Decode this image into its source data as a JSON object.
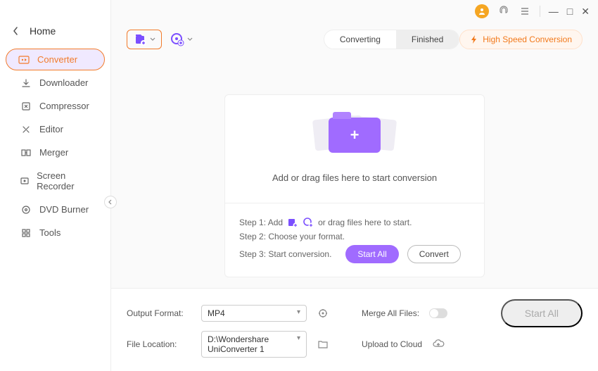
{
  "home": {
    "label": "Home"
  },
  "sidebar": {
    "items": [
      {
        "label": "Converter"
      },
      {
        "label": "Downloader"
      },
      {
        "label": "Compressor"
      },
      {
        "label": "Editor"
      },
      {
        "label": "Merger"
      },
      {
        "label": "Screen Recorder"
      },
      {
        "label": "DVD Burner"
      },
      {
        "label": "Tools"
      }
    ]
  },
  "tabs": {
    "converting": "Converting",
    "finished": "Finished"
  },
  "hispeed": {
    "label": "High Speed Conversion"
  },
  "drop": {
    "message": "Add or drag files here to start conversion",
    "step1_a": "Step 1: Add",
    "step1_b": "or drag files here to start.",
    "step2": "Step 2: Choose your format.",
    "step3": "Step 3: Start conversion.",
    "startall": "Start All",
    "convert": "Convert"
  },
  "bottom": {
    "output_label": "Output Format:",
    "output_value": "MP4",
    "location_label": "File Location:",
    "location_value": "D:\\Wondershare UniConverter 1",
    "merge_label": "Merge All Files:",
    "upload_label": "Upload to Cloud",
    "startall": "Start All"
  },
  "colors": {
    "accent": "#f27b2b",
    "primary": "#a06bff"
  }
}
